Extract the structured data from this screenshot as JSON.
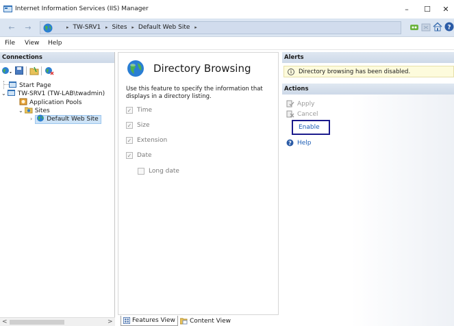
{
  "window": {
    "title": "Internet Information Services (IIS) Manager",
    "minimize": "–",
    "maximize": "☐",
    "close": "✕"
  },
  "address": {
    "back": "←",
    "forward": "→",
    "crumbs": [
      "TW-SRV1",
      "Sites",
      "Default Web Site"
    ],
    "separator": "▸"
  },
  "menu": [
    "File",
    "View",
    "Help"
  ],
  "connections": {
    "header": "Connections",
    "tree": {
      "start_page": "Start Page",
      "server": "TW-SRV1 (TW-LAB\\twadmin)",
      "app_pools": "Application Pools",
      "sites": "Sites",
      "default_site": "Default Web Site"
    },
    "scroll_left": "<",
    "scroll_right": ">"
  },
  "feature": {
    "title": "Directory Browsing",
    "description": "Use this feature to specify the information that displays in a directory listing.",
    "options": [
      {
        "label": "Time",
        "checked": true
      },
      {
        "label": "Size",
        "checked": true
      },
      {
        "label": "Extension",
        "checked": true
      },
      {
        "label": "Date",
        "checked": true
      },
      {
        "label": "Long date",
        "checked": false
      }
    ]
  },
  "view_tabs": {
    "features": "Features View",
    "content": "Content View"
  },
  "alerts": {
    "header": "Alerts",
    "message": "Directory browsing has been disabled."
  },
  "actions": {
    "header": "Actions",
    "apply": "Apply",
    "cancel": "Cancel",
    "enable": "Enable",
    "help": "Help"
  },
  "colors": {
    "link": "#1a5bb4",
    "highlight_box": "#1a1a8c",
    "alert_bg": "#fdfbdc",
    "pane_header": "#cdd9e8"
  }
}
